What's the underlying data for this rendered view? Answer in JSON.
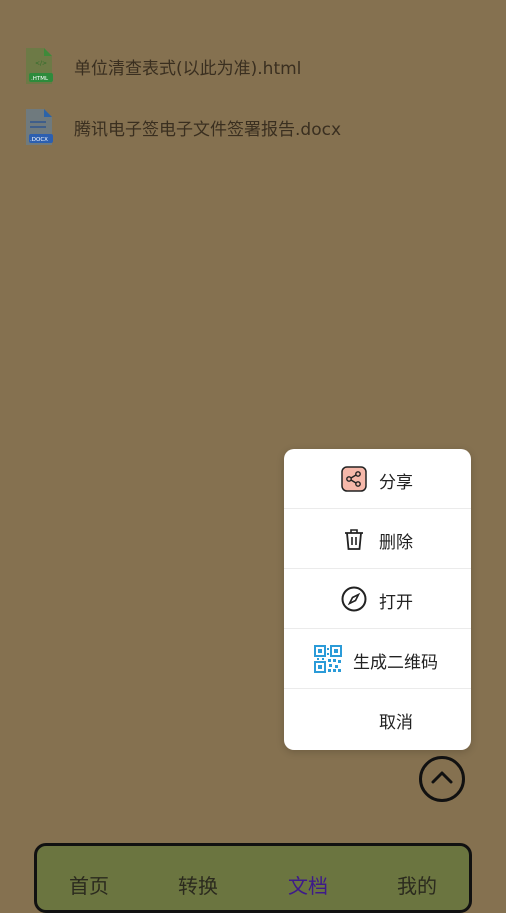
{
  "files": [
    {
      "name": "单位清查表式(以此为准).html",
      "badge": ".HTML"
    },
    {
      "name": "腾讯电子签电子文件签署报告.docx",
      "badge": ".DOCX"
    }
  ],
  "menu": {
    "items": [
      {
        "label": "分享",
        "icon": "share-icon"
      },
      {
        "label": "删除",
        "icon": "trash-icon"
      },
      {
        "label": "打开",
        "icon": "compass-icon"
      },
      {
        "label": "生成二维码",
        "icon": "qr-code-icon"
      },
      {
        "label": "取消",
        "icon": ""
      }
    ]
  },
  "tabs": [
    {
      "label": "首页",
      "active": false
    },
    {
      "label": "转换",
      "active": false
    },
    {
      "label": "文档",
      "active": true
    },
    {
      "label": "我的",
      "active": false
    }
  ],
  "colors": {
    "overlay_bg": "#857150",
    "tab_active": "#3d1a8a",
    "tabbar_bg": "#6b7540"
  }
}
